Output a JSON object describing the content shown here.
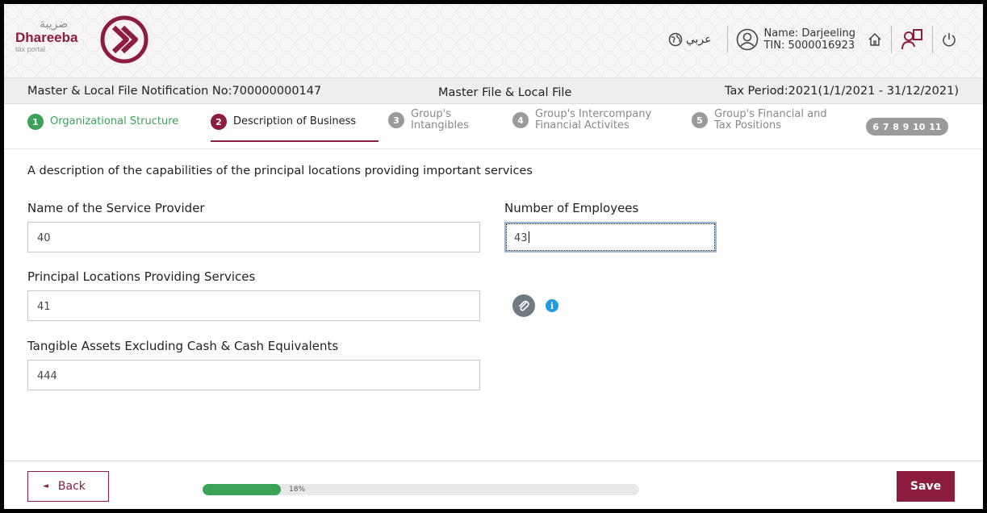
{
  "header": {
    "logo_arabic": "ضريبة",
    "logo_name": "Dhareeba",
    "logo_sub": "tax portal",
    "language_label": "عربي",
    "user_name": "Name: Darjeeling",
    "user_tin": "TIN: 5000016923",
    "icons": [
      "globe-icon",
      "user-icon",
      "home-icon",
      "guide-icon",
      "power-icon"
    ]
  },
  "titlebar": {
    "notification": "Master & Local File Notification No:700000000147",
    "form_title": "Master File & Local File",
    "tax_period": "Tax Period:2021(1/1/2021 - 31/12/2021)"
  },
  "stepper": {
    "steps": [
      {
        "num": "1",
        "label": "Organizational Structure",
        "state": "done"
      },
      {
        "num": "2",
        "label": "Description of Business",
        "state": "active"
      },
      {
        "num": "3",
        "label_l1": "Group's",
        "label_l2": "Intangibles",
        "state": "todo"
      },
      {
        "num": "4",
        "label_l1": "Group's Intercompany",
        "label_l2": "Financial Activites",
        "state": "todo"
      },
      {
        "num": "5",
        "label_l1": "Group's Financial and",
        "label_l2": "Tax Positions",
        "state": "todo"
      }
    ],
    "more": [
      "6",
      "7",
      "8",
      "9",
      "10",
      "11"
    ]
  },
  "form": {
    "description": "A description of the capabilities of the principal locations providing important services",
    "service_provider_label": "Name of the Service Provider",
    "service_provider_value": "40",
    "employees_label": "Number of Employees",
    "employees_value": "43",
    "locations_label": "Principal Locations Providing Services",
    "locations_value": "41",
    "tangible_label": "Tangible Assets Excluding Cash & Cash Equivalents",
    "tangible_value": "444"
  },
  "footer": {
    "back_label": "Back",
    "progress_text": "18%",
    "progress_value": 18,
    "save_label": "Save"
  },
  "colors": {
    "brand": "#8c1d3f",
    "success": "#3aa355",
    "info": "#1e9be3"
  }
}
